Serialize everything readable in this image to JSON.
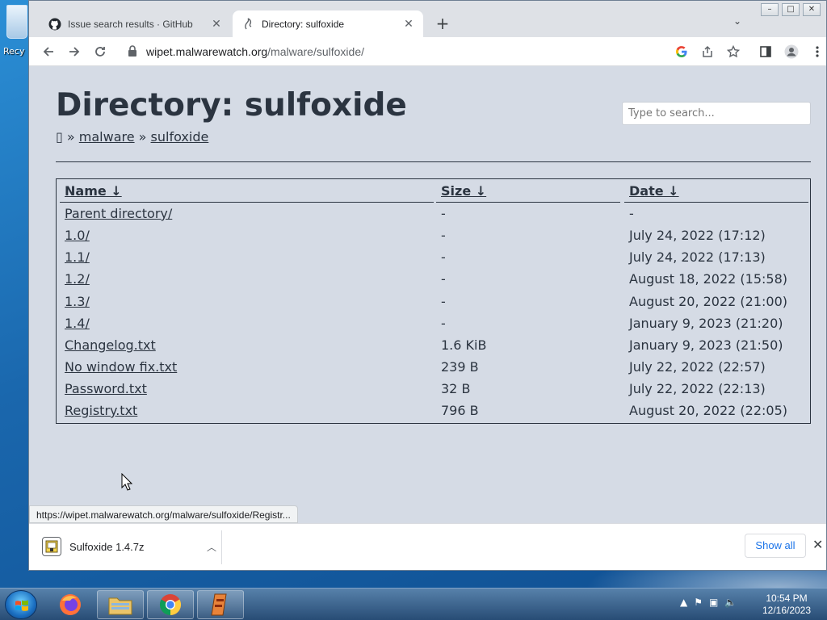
{
  "desktop": {
    "recycle_label": "Recy"
  },
  "browser": {
    "tabs": [
      {
        "title": "Issue search results · GitHub",
        "active": false
      },
      {
        "title": "Directory: sulfoxide",
        "active": true
      }
    ],
    "newtab_glyph": "+",
    "url_host": "wipet.malwarewatch.org",
    "url_path": "/malware/sulfoxide/"
  },
  "page": {
    "heading": "Directory: sulfoxide",
    "breadcrumb": {
      "home_glyph": "▯",
      "sep": " » ",
      "items": [
        "malware",
        "sulfoxide"
      ]
    },
    "search_placeholder": "Type to search...",
    "columns": {
      "name": "Name ↓",
      "size": "Size ↓",
      "date": "Date ↓"
    },
    "rows": [
      {
        "name": "Parent directory/",
        "size": "-",
        "date": "-"
      },
      {
        "name": "1.0/",
        "size": "-",
        "date": "July 24, 2022 (17:12)"
      },
      {
        "name": "1.1/",
        "size": "-",
        "date": "July 24, 2022 (17:13)"
      },
      {
        "name": "1.2/",
        "size": "-",
        "date": "August 18, 2022 (15:58)"
      },
      {
        "name": "1.3/",
        "size": "-",
        "date": "August 20, 2022 (21:00)"
      },
      {
        "name": "1.4/",
        "size": "-",
        "date": "January 9, 2023 (21:20)"
      },
      {
        "name": "Changelog.txt",
        "size": "1.6 KiB",
        "date": "January 9, 2023 (21:50)"
      },
      {
        "name": "No window fix.txt",
        "size": "239 B",
        "date": "July 22, 2022 (22:57)"
      },
      {
        "name": "Password.txt",
        "size": "32 B",
        "date": "July 22, 2022 (22:13)"
      },
      {
        "name": "Registry.txt",
        "size": "796 B",
        "date": "August 20, 2022 (22:05)"
      }
    ],
    "status_url": "https://wipet.malwarewatch.org/malware/sulfoxide/Registr..."
  },
  "downloads": {
    "file_name": "Sulfoxide 1.4.7z",
    "show_all": "Show all"
  },
  "taskbar": {
    "time": "10:54 PM",
    "date": "12/16/2023"
  },
  "colors": {
    "page_bg": "#d5dbe5",
    "text": "#2b3440",
    "link_blue": "#1a73e8"
  }
}
